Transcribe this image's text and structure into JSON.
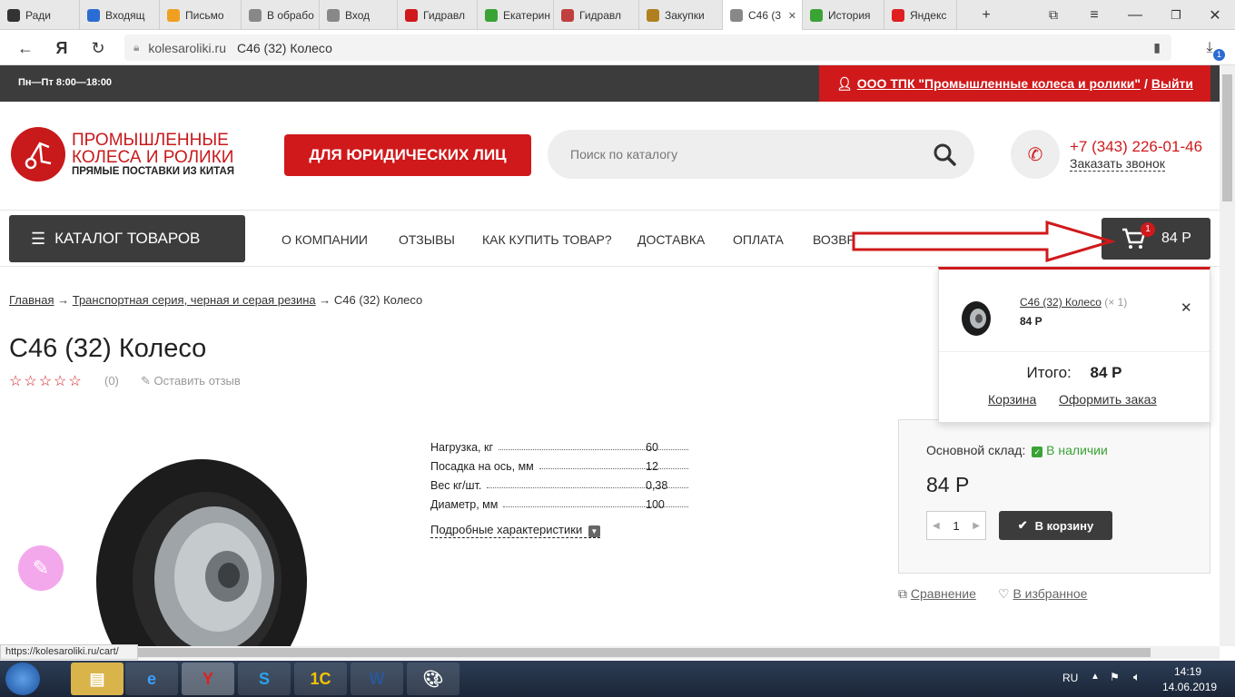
{
  "browser": {
    "tabs": [
      {
        "label": "Ради",
        "icon": "mail-icon",
        "color": "#333333"
      },
      {
        "label": "Входящ",
        "icon": "at-icon",
        "color": "#2b6cd4"
      },
      {
        "label": "Письмо",
        "icon": "mail-icon",
        "color": "#f0a020"
      },
      {
        "label": "В обрабо",
        "icon": "page-icon",
        "color": "#888888"
      },
      {
        "label": "Вход",
        "icon": "page-icon",
        "color": "#888888"
      },
      {
        "label": "Гидравл",
        "icon": "n-icon",
        "color": "#d0191b"
      },
      {
        "label": "Екатерин",
        "icon": "browser-icon",
        "color": "#3aa335"
      },
      {
        "label": "Гидравл",
        "icon": "forklift-icon",
        "color": "#c04040"
      },
      {
        "label": "Закупки",
        "icon": "emblem-icon",
        "color": "#b08020"
      },
      {
        "label": "С46 (3",
        "icon": "page-icon",
        "color": "#888888",
        "active": true
      },
      {
        "label": "История",
        "icon": "browser-icon",
        "color": "#3aa335"
      },
      {
        "label": "Яндекс",
        "icon": "yandex-icon",
        "color": "#e02020"
      }
    ],
    "url_domain": "kolesaroliki.ru",
    "url_title": "С46 (32) Колесо",
    "download_count": "1",
    "status_url": "https://kolesaroliki.ru/cart/"
  },
  "site": {
    "hours": "Пн—Пт 8:00—18:00",
    "user_company": "ООО ТПК \"Промышленные колеса и ролики\"",
    "user_sep": "/",
    "logout": "Выйти",
    "logo_line1": "ПРОМЫШЛЕННЫЕ",
    "logo_line2": "КОЛЕСА И РОЛИКИ",
    "logo_line3": "ПРЯМЫЕ ПОСТАВКИ ИЗ КИТАЯ",
    "legal_button": "ДЛЯ ЮРИДИЧЕСКИХ ЛИЦ",
    "search_placeholder": "Поиск по каталогу",
    "phone": "+7 (343) 226-01-46",
    "callback": "Заказать звонок",
    "catalog_button": "КАТАЛОГ ТОВАРОВ",
    "nav": [
      "О КОМПАНИИ",
      "ОТЗЫВЫ",
      "КАК КУПИТЬ ТОВАР?",
      "ДОСТАВКА",
      "ОПЛАТА",
      "ВОЗВР"
    ],
    "cart_badge": "1",
    "cart_total": "84 Р"
  },
  "breadcrumb": {
    "home": "Главная",
    "arrow": "→",
    "category": "Транспортная серия, черная и серая резина",
    "current": "С46 (32) Колесо"
  },
  "product": {
    "title": "С46 (32) Колесо",
    "rating_count": "(0)",
    "review_link": "Оставить отзыв",
    "specs": [
      {
        "k": "Нагрузка, кг",
        "v": "60"
      },
      {
        "k": "Посадка на ось, мм",
        "v": "12"
      },
      {
        "k": "Вес кг/шт.",
        "v": "0,38"
      },
      {
        "k": "Диаметр, мм",
        "v": "100"
      }
    ],
    "more_specs": "Подробные характеристики",
    "warehouse": "Основной склад:",
    "availability": "В наличии",
    "price": "84 Р",
    "qty": "1",
    "buy_button": "В корзину",
    "compare": "Сравнение",
    "favorite": "В избранное"
  },
  "cart_popup": {
    "item_name": "С46 (32) Колесо",
    "item_qty": "(× 1)",
    "item_price": "84 Р",
    "total_label": "Итого:",
    "total_value": "84 Р",
    "cart_link": "Корзина",
    "checkout_link": "Оформить заказ"
  },
  "taskbar": {
    "lang": "RU",
    "time": "14:19",
    "date": "14.06.2019"
  },
  "colors": {
    "brand_red": "#d0191b",
    "dark": "#3c3c3c",
    "stock_green": "#3aa335"
  }
}
